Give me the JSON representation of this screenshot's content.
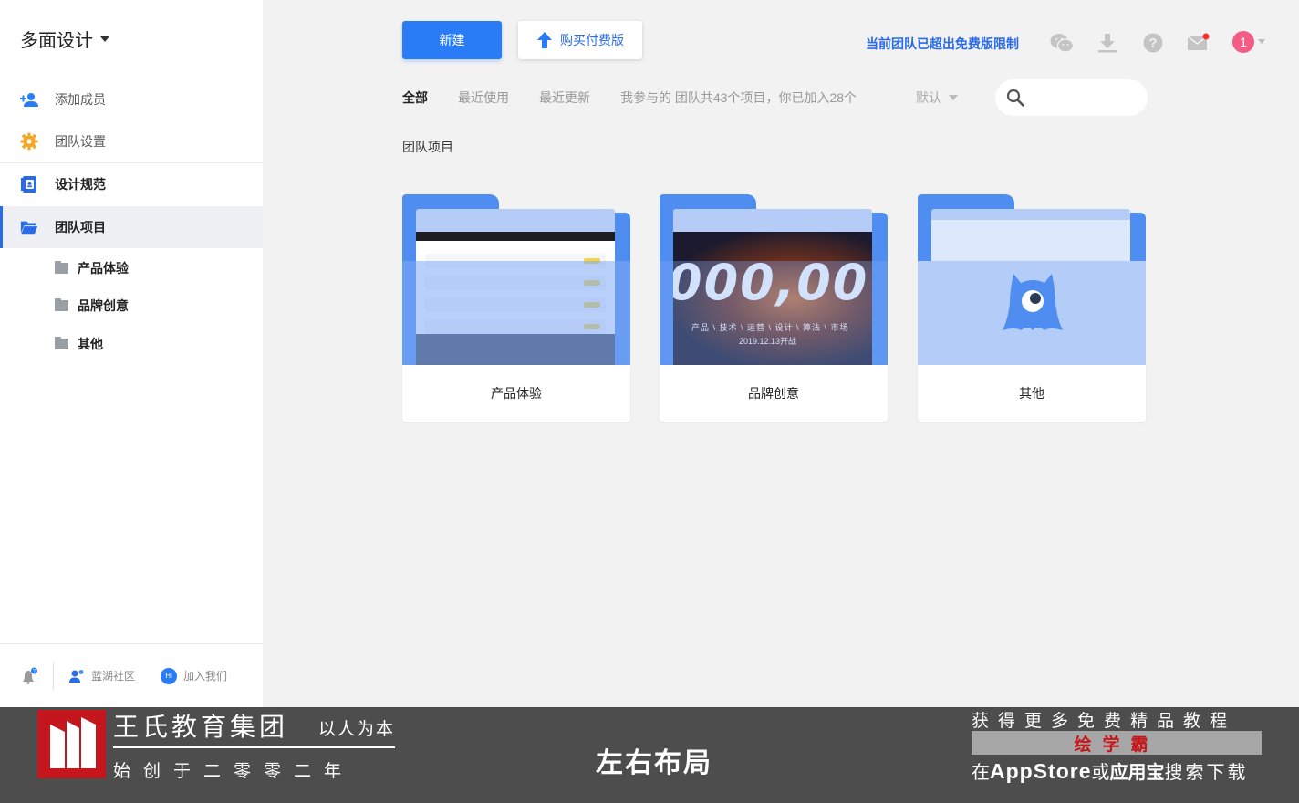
{
  "sidebar": {
    "team_name": "多面设计",
    "menu": [
      {
        "label": "添加成员",
        "icon": "add-user-icon"
      },
      {
        "label": "团队设置",
        "icon": "gear-icon"
      },
      {
        "label": "设计规范",
        "icon": "design-spec-icon"
      },
      {
        "label": "团队项目",
        "icon": "folder-open-icon"
      }
    ],
    "sub_folders": [
      "产品体验",
      "品牌创意",
      "其他"
    ],
    "footer": {
      "community": "蓝湖社区",
      "join_us": "加入我们",
      "hi_badge": "Hi"
    }
  },
  "toolbar": {
    "new_label": "新建",
    "buy_label": "购买付费版",
    "limit_notice": "当前团队已超出免费版限制",
    "avatar_text": "1"
  },
  "filters": {
    "all": "全部",
    "recent_used": "最近使用",
    "recent_updated": "最近更新",
    "summary": "我参与的 团队共43个项目，你已加入28个",
    "sort": "默认",
    "search_placeholder": ""
  },
  "main": {
    "section_title": "团队项目",
    "folders": [
      "产品体验",
      "品牌创意",
      "其他"
    ],
    "poster_number": "000,00",
    "poster_tags": "产品 \\ 技术 \\ 运营 \\ 设计 \\ 算法 \\ 市场",
    "poster_date": "2019.12.13开战"
  },
  "banner": {
    "brand_name": "王氏教育集团",
    "motto": "以人为本",
    "founded": "始创于二零零二年",
    "center_title": "左右布局",
    "promo_top": "获得更多免费精品教程",
    "promo_app": "绘学霸",
    "promo_prefix": "在",
    "promo_store": "AppStore",
    "promo_or": "或",
    "promo_yyb": "应用宝",
    "promo_suffix": "搜索下载"
  },
  "colors": {
    "primary": "#2a7cf6",
    "folder_blue": "#4f8ef0",
    "badge_red": "#f25c85",
    "banner_bg": "#4d4d4d",
    "logo_red": "#c4161c"
  }
}
